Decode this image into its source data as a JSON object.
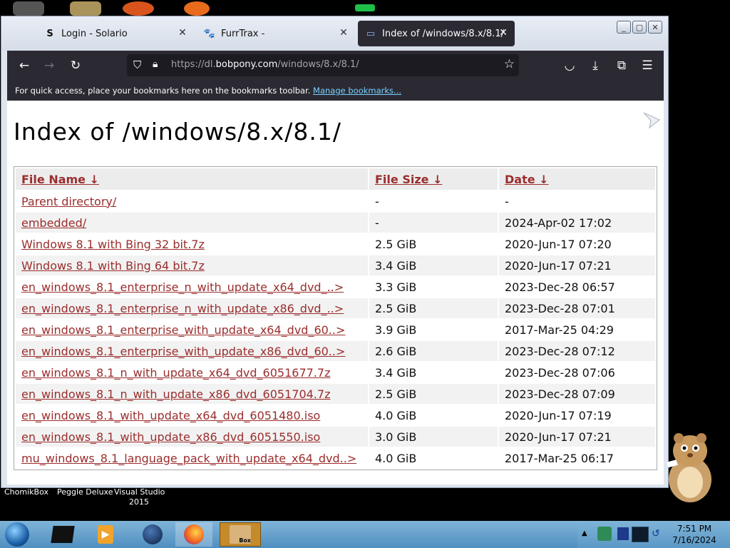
{
  "desktop": {
    "icons": [
      {
        "label": "ChomikBox"
      },
      {
        "label": "Peggle Deluxe"
      },
      {
        "label": "Visual Studio\n2015"
      }
    ]
  },
  "browser": {
    "tabs": [
      {
        "label": "Login - Solario",
        "icon": "S"
      },
      {
        "label": "FurrTrax -",
        "icon": "🐾"
      },
      {
        "label": "Index of /windows/8.x/8.1/",
        "icon": "▭"
      }
    ],
    "url": {
      "prefix": "https://dl.",
      "host": "bobpony.com",
      "path": "/windows/8.x/8.1/"
    },
    "bookmarks_bar": {
      "text": "For quick access, place your bookmarks here on the bookmarks toolbar.",
      "link": "Manage bookmarks..."
    }
  },
  "page": {
    "title": "Index of /windows/8.x/8.1/",
    "columns": [
      "File Name  ↓",
      "File Size  ↓",
      "Date  ↓"
    ],
    "rows": [
      {
        "name": "Parent directory/",
        "size": "-",
        "date": "-"
      },
      {
        "name": "embedded/",
        "size": "-",
        "date": "2024-Apr-02 17:02"
      },
      {
        "name": "Windows 8.1 with Bing 32 bit.7z",
        "size": "2.5 GiB",
        "date": "2020-Jun-17 07:20"
      },
      {
        "name": "Windows 8.1 with Bing 64 bit.7z",
        "size": "3.4 GiB",
        "date": "2020-Jun-17 07:21"
      },
      {
        "name": "en_windows_8.1_enterprise_n_with_update_x64_dvd_..>",
        "size": "3.3 GiB",
        "date": "2023-Dec-28 06:57"
      },
      {
        "name": "en_windows_8.1_enterprise_n_with_update_x86_dvd_..>",
        "size": "2.5 GiB",
        "date": "2023-Dec-28 07:01"
      },
      {
        "name": "en_windows_8.1_enterprise_with_update_x64_dvd_60..>",
        "size": "3.9 GiB",
        "date": "2017-Mar-25 04:29"
      },
      {
        "name": "en_windows_8.1_enterprise_with_update_x86_dvd_60..>",
        "size": "2.6 GiB",
        "date": "2023-Dec-28 07:12"
      },
      {
        "name": "en_windows_8.1_n_with_update_x64_dvd_6051677.7z",
        "size": "3.4 GiB",
        "date": "2023-Dec-28 07:06"
      },
      {
        "name": "en_windows_8.1_n_with_update_x86_dvd_6051704.7z",
        "size": "2.5 GiB",
        "date": "2023-Dec-28 07:09"
      },
      {
        "name": "en_windows_8.1_with_update_x64_dvd_6051480.iso",
        "size": "4.0 GiB",
        "date": "2020-Jun-17 07:19"
      },
      {
        "name": "en_windows_8.1_with_update_x86_dvd_6051550.iso",
        "size": "3.0 GiB",
        "date": "2020-Jun-17 07:21"
      },
      {
        "name": "mu_windows_8.1_language_pack_with_update_x64_dvd..>",
        "size": "4.0 GiB",
        "date": "2017-Mar-25 06:17"
      }
    ]
  },
  "taskbar": {
    "time": "7:51 PM",
    "date": "7/16/2024",
    "app_icons": [
      "start-orb-icon",
      "chomikbox-icon",
      "media-player-icon",
      "globe-icon",
      "firefox-icon",
      "chomikbox-box-icon"
    ],
    "active_color": "#c58a2a"
  }
}
